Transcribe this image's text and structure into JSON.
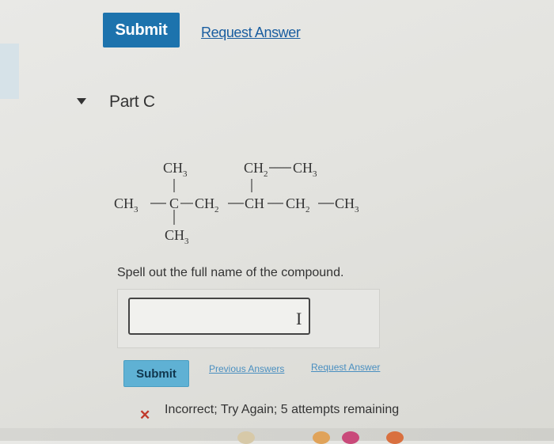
{
  "toolbar_top": {
    "submit_label": "Submit",
    "request_answer_label": "Request Answer"
  },
  "part": {
    "title": "Part C"
  },
  "formula": {
    "top_left_group": "CH",
    "top_left_sub": "3",
    "top_right_group_a": "CH",
    "top_right_sub_a": "2",
    "top_right_group_b": "CH",
    "top_right_sub_b": "3",
    "main_chain": [
      {
        "text": "CH",
        "sub": "3"
      },
      {
        "text": "C",
        "sub": ""
      },
      {
        "text": "CH",
        "sub": "2"
      },
      {
        "text": "CH",
        "sub": ""
      },
      {
        "text": "CH",
        "sub": "2"
      },
      {
        "text": "CH",
        "sub": "3"
      }
    ],
    "bottom_group": "CH",
    "bottom_sub": "3"
  },
  "question": {
    "prompt": "Spell out the full name of the compound.",
    "answer_value": "",
    "answer_placeholder": ""
  },
  "toolbar_bottom": {
    "submit_label": "Submit",
    "previous_answers_label": "Previous Answers",
    "request_answer_label": "Request Answer"
  },
  "feedback": {
    "icon": "x-icon",
    "message": "Incorrect; Try Again; 5 attempts remaining",
    "color": "#c0392b"
  },
  "colors": {
    "primary_button": "#1d73ad",
    "secondary_button": "#5fb1d4",
    "link": "#1a5ea0"
  }
}
